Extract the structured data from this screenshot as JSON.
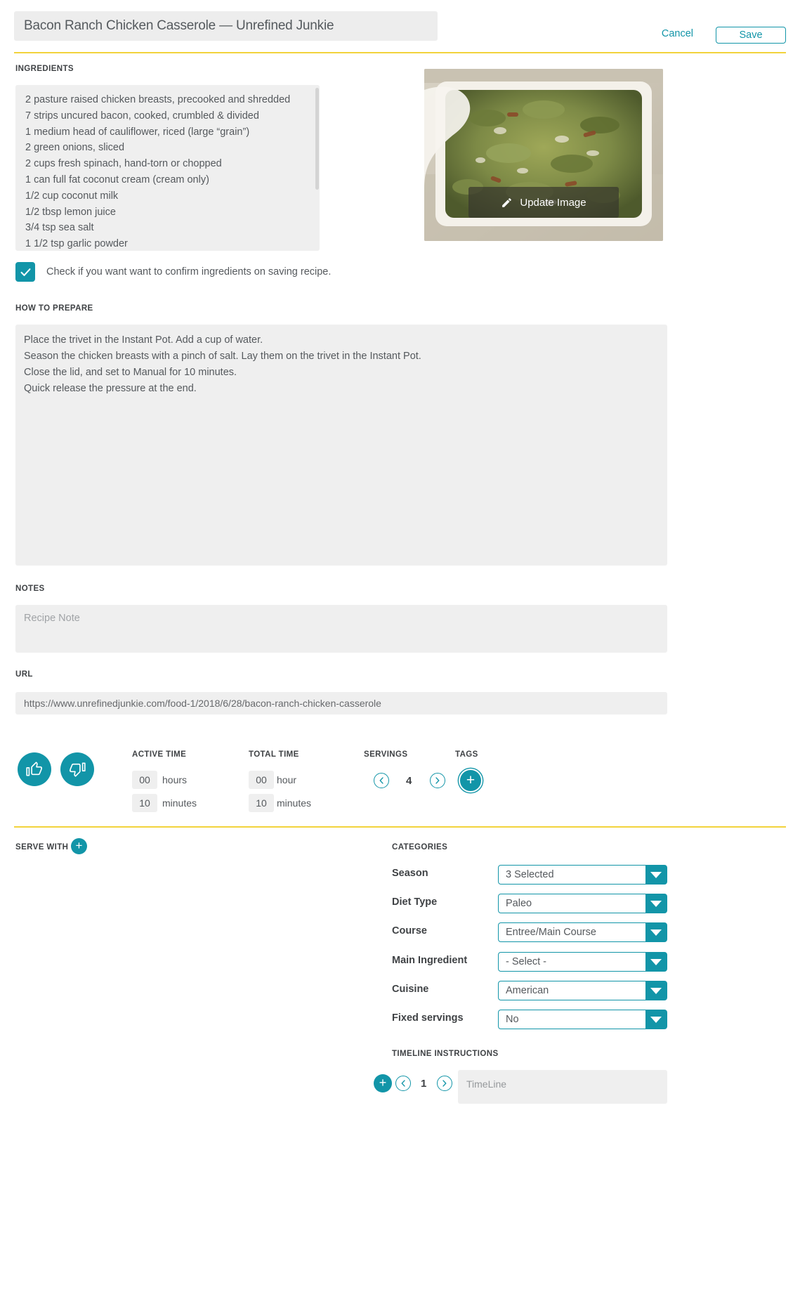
{
  "header": {
    "title": "Bacon Ranch Chicken Casserole — Unrefined Junkie",
    "cancel_label": "Cancel",
    "save_label": "Save"
  },
  "ingredients": {
    "label": "INGREDIENTS",
    "items": [
      "2 pasture raised chicken breasts, precooked and shredded",
      "7 strips uncured bacon, cooked, crumbled & divided",
      "1 medium head of cauliflower, riced (large “grain”)",
      "2 green onions, sliced",
      "2 cups fresh spinach, hand-torn or chopped",
      "1 can full fat coconut cream (cream only)",
      "1/2 cup coconut milk",
      "1/2 tbsp lemon juice",
      "3/4 tsp sea salt",
      "1 1/2 tsp garlic powder"
    ]
  },
  "image": {
    "update_label": "Update Image"
  },
  "confirm": {
    "checked": true,
    "text": "Check if you want want to confirm ingredients on saving recipe."
  },
  "prepare": {
    "label": "HOW TO PREPARE",
    "lines": [
      "Place the trivet in the Instant Pot. Add a cup of water.",
      "Season the chicken breasts with a pinch of salt. Lay them on the trivet in the Instant Pot.",
      "Close the lid, and set to Manual for 10 minutes.",
      "Quick release the pressure at the end."
    ]
  },
  "notes": {
    "label": "NOTES",
    "placeholder": "Recipe Note",
    "value": ""
  },
  "url": {
    "label": "URL",
    "value": "https://www.unrefinedjunkie.com/food-1/2018/6/28/bacon-ranch-chicken-casserole"
  },
  "meta": {
    "active_time": {
      "label": "ACTIVE TIME",
      "hours_value": "00",
      "hours_unit": "hours",
      "minutes_value": "10",
      "minutes_unit": "minutes"
    },
    "total_time": {
      "label": "TOTAL TIME",
      "hours_value": "00",
      "hours_unit": "hour",
      "minutes_value": "10",
      "minutes_unit": "minutes"
    },
    "servings": {
      "label": "SERVINGS",
      "value": "4",
      "prev_icon": "chevron-left-icon",
      "next_icon": "chevron-right-icon"
    },
    "tags": {
      "label": "TAGS",
      "add_icon": "plus-icon"
    }
  },
  "serve_with": {
    "label": "SERVE WITH",
    "add_icon": "plus-icon"
  },
  "categories": {
    "label": "CATEGORIES",
    "rows": [
      {
        "name": "Season",
        "value": "3 Selected"
      },
      {
        "name": "Diet Type",
        "value": "Paleo"
      },
      {
        "name": "Course",
        "value": "Entree/Main Course"
      },
      {
        "name": "Main Ingredient",
        "value": "- Select -"
      },
      {
        "name": "Cuisine",
        "value": "American"
      },
      {
        "name": "Fixed servings",
        "value": "No"
      }
    ]
  },
  "timeline": {
    "label": "TIMELINE INSTRUCTIONS",
    "page_number": "1",
    "placeholder": "TimeLine"
  },
  "colors": {
    "accent": "#1295a8",
    "rule": "#f2d33c",
    "field_bg": "#efefef"
  }
}
